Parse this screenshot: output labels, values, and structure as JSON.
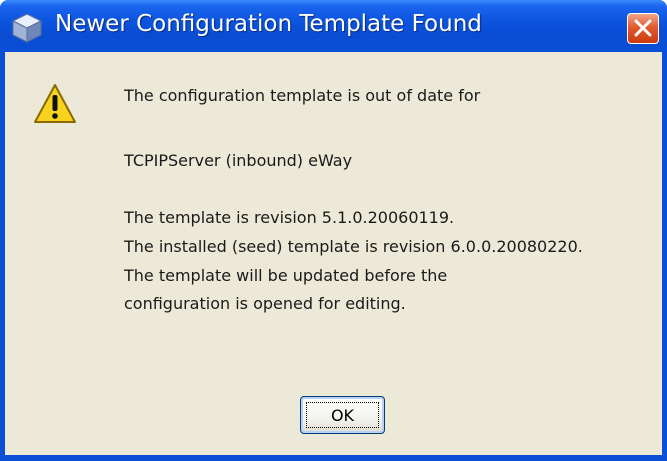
{
  "window": {
    "title": "Newer Configuration Template Found",
    "title_icon": "cube-icon",
    "close_icon": "close-icon"
  },
  "message": {
    "icon": "warning-icon",
    "line1": "The configuration template is out of date for",
    "line2": "TCPIPServer (inbound) eWay",
    "line3": "The template is revision 5.1.0.20060119.",
    "line4": "The installed (seed) template is revision 6.0.0.20080220.",
    "line5": "The template will be updated before the",
    "line6": "configuration is opened for editing."
  },
  "buttons": {
    "ok_label": "OK"
  },
  "colors": {
    "titlebar": "#0a4fd6",
    "dialog_body": "#ece9d8",
    "close_button": "#e25a2e",
    "warning_yellow": "#f7d21e"
  }
}
